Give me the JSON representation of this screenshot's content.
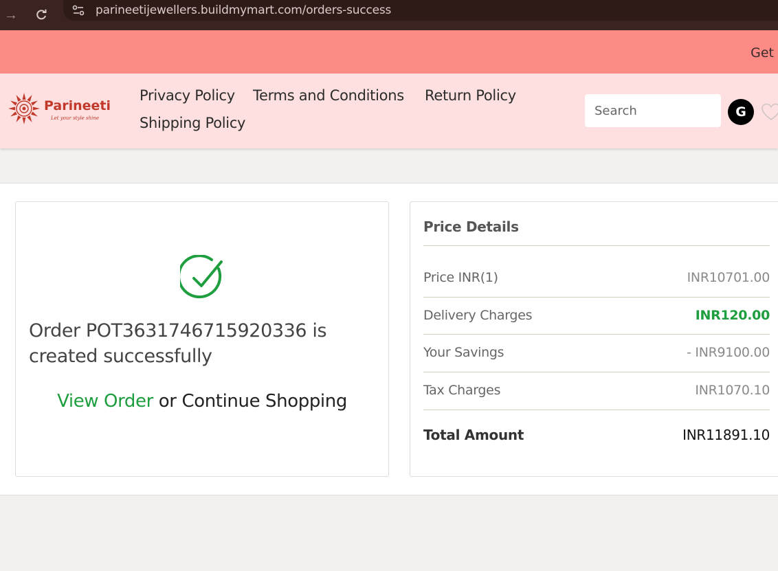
{
  "browser": {
    "url": "parineetijewellers.buildmymart.com/orders-success"
  },
  "announcement": {
    "text": "Get"
  },
  "brand": {
    "name": "Parineeti",
    "tagline": "Let your style shine"
  },
  "nav": {
    "items": [
      {
        "label": "Privacy Policy"
      },
      {
        "label": "Terms and Conditions"
      },
      {
        "label": "Return Policy"
      },
      {
        "label": "Shipping Policy"
      }
    ]
  },
  "search": {
    "placeholder": "Search"
  },
  "user": {
    "initial": "G"
  },
  "order": {
    "message": "Order POT3631746715920336 is created successfully",
    "view_order_label": "View Order",
    "or_text": " or ",
    "continue_label": "Continue Shopping"
  },
  "price_details": {
    "title": "Price Details",
    "rows": [
      {
        "label": "Price INR(1)",
        "value": "INR10701.00"
      },
      {
        "label": "Delivery Charges",
        "value": "INR120.00"
      },
      {
        "label": "Your Savings",
        "value": "- INR9100.00"
      },
      {
        "label": "Tax Charges",
        "value": "INR1070.10"
      }
    ],
    "total": {
      "label": "Total Amount",
      "value": "INR11891.10"
    }
  },
  "colors": {
    "announcement_bg": "#fc8b86",
    "header_bg": "#fde0df",
    "success_green": "#1e9e3e"
  }
}
